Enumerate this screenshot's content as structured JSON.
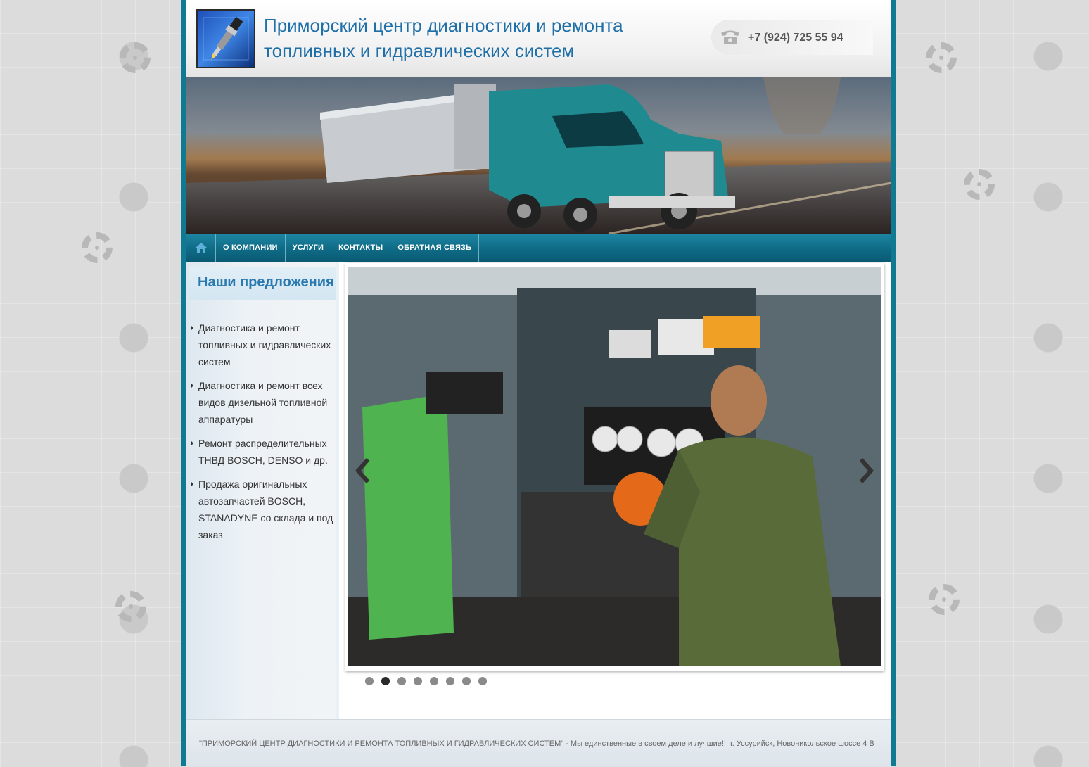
{
  "header": {
    "title_line1": "Приморский центр диагностики и ремонта",
    "title_line2": "топливных и гидравлических систем",
    "phone": "+7 (924) 725 55 94"
  },
  "nav": {
    "items": [
      "О КОМПАНИИ",
      "УСЛУГИ",
      "КОНТАКТЫ",
      "ОБРАТНАЯ СВЯЗЬ"
    ]
  },
  "sidebar": {
    "title": "Наши предложения",
    "items": [
      "Диагностика и ремонт топливных и гидравлических систем",
      "Диагностика и ремонт всех видов дизельной топливной аппаратуры",
      "Ремонт распределительных ТНВД BOSCH, DENSO и др.",
      "Продажа оригинальных автозапчастей BOSCH, STANADYNE со склада и под заказ"
    ]
  },
  "slider": {
    "active_index": 2,
    "dot_count": 8
  },
  "footer": {
    "text": "\"ПРИМОРСКИЙ ЦЕНТР ДИАГНОСТИКИ И РЕМОНТА ТОПЛИВНЫХ И ГИДРАВЛИЧЕСКИХ СИСТЕМ\" - Мы единственные в своем деле и лучшие!!! г. Уссурийск, Новоникольское шоссе 4 В"
  },
  "colors": {
    "frame": "#0f7a92",
    "title": "#1f6fa8",
    "nav": "#0f6b86"
  }
}
